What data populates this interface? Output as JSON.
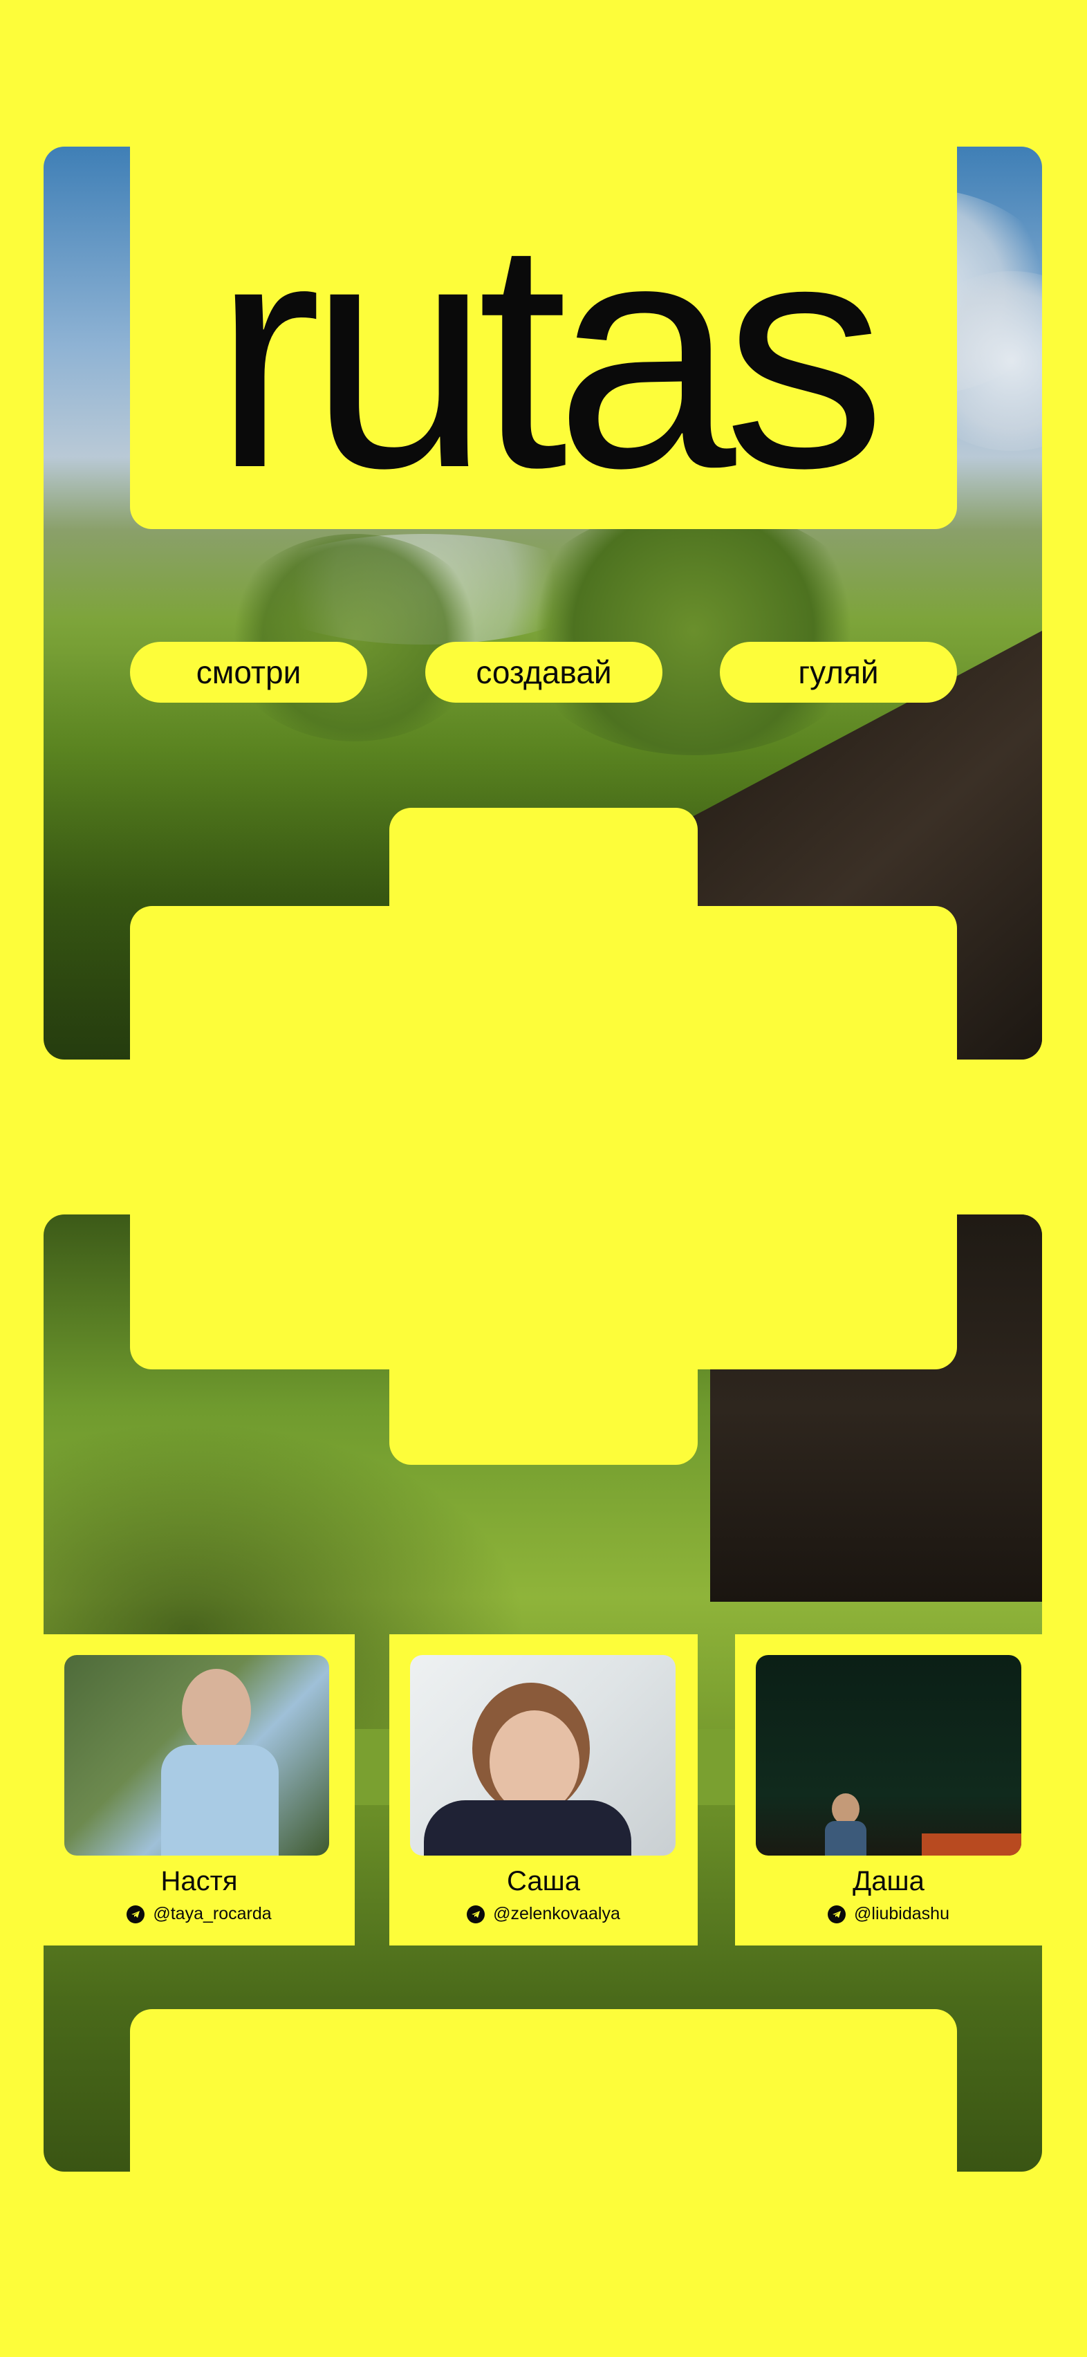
{
  "brand": {
    "title": "rutas"
  },
  "nav": {
    "items": [
      "смотри",
      "создавай",
      "гуляй"
    ]
  },
  "team": [
    {
      "name": "Настя",
      "handle": "@taya_rocarda",
      "icon": "telegram-icon"
    },
    {
      "name": "Саша",
      "handle": "@zelenkovaalya",
      "icon": "telegram-icon"
    },
    {
      "name": "Даша",
      "handle": "@liubidashu",
      "icon": "telegram-icon"
    }
  ],
  "colors": {
    "background": "#fdfd3a",
    "text": "#0a0a0a"
  }
}
